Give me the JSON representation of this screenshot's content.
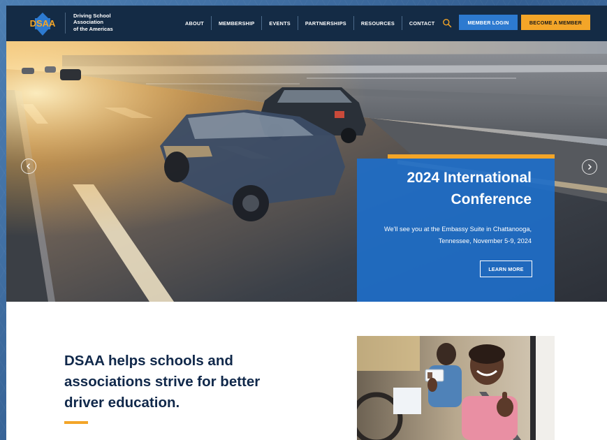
{
  "brand": {
    "logo_text": "DSAA",
    "name_lines": [
      "Driving School",
      "Association",
      "of the Americas"
    ]
  },
  "nav": {
    "items": [
      "ABOUT",
      "MEMBERSHIP",
      "EVENTS",
      "PARTNERSHIPS",
      "RESOURCES",
      "CONTACT"
    ]
  },
  "header": {
    "login_label": "MEMBER LOGIN",
    "member_label": "BECOME A MEMBER"
  },
  "hero": {
    "title": "2024 International Conference",
    "description": "We'll see you at the Embassy Suite in Chattanooga, Tennessee, November 5-9, 2024",
    "cta_label": "LEARN MORE"
  },
  "intro": {
    "heading": "DSAA helps schools and associations strive for better driver education."
  },
  "colors": {
    "navy": "#142b45",
    "accent_orange": "#f3a528",
    "blue": "#2d7ad0",
    "heading": "#10284a"
  },
  "icons": [
    "search-icon",
    "chevron-left-icon",
    "chevron-right-icon"
  ]
}
